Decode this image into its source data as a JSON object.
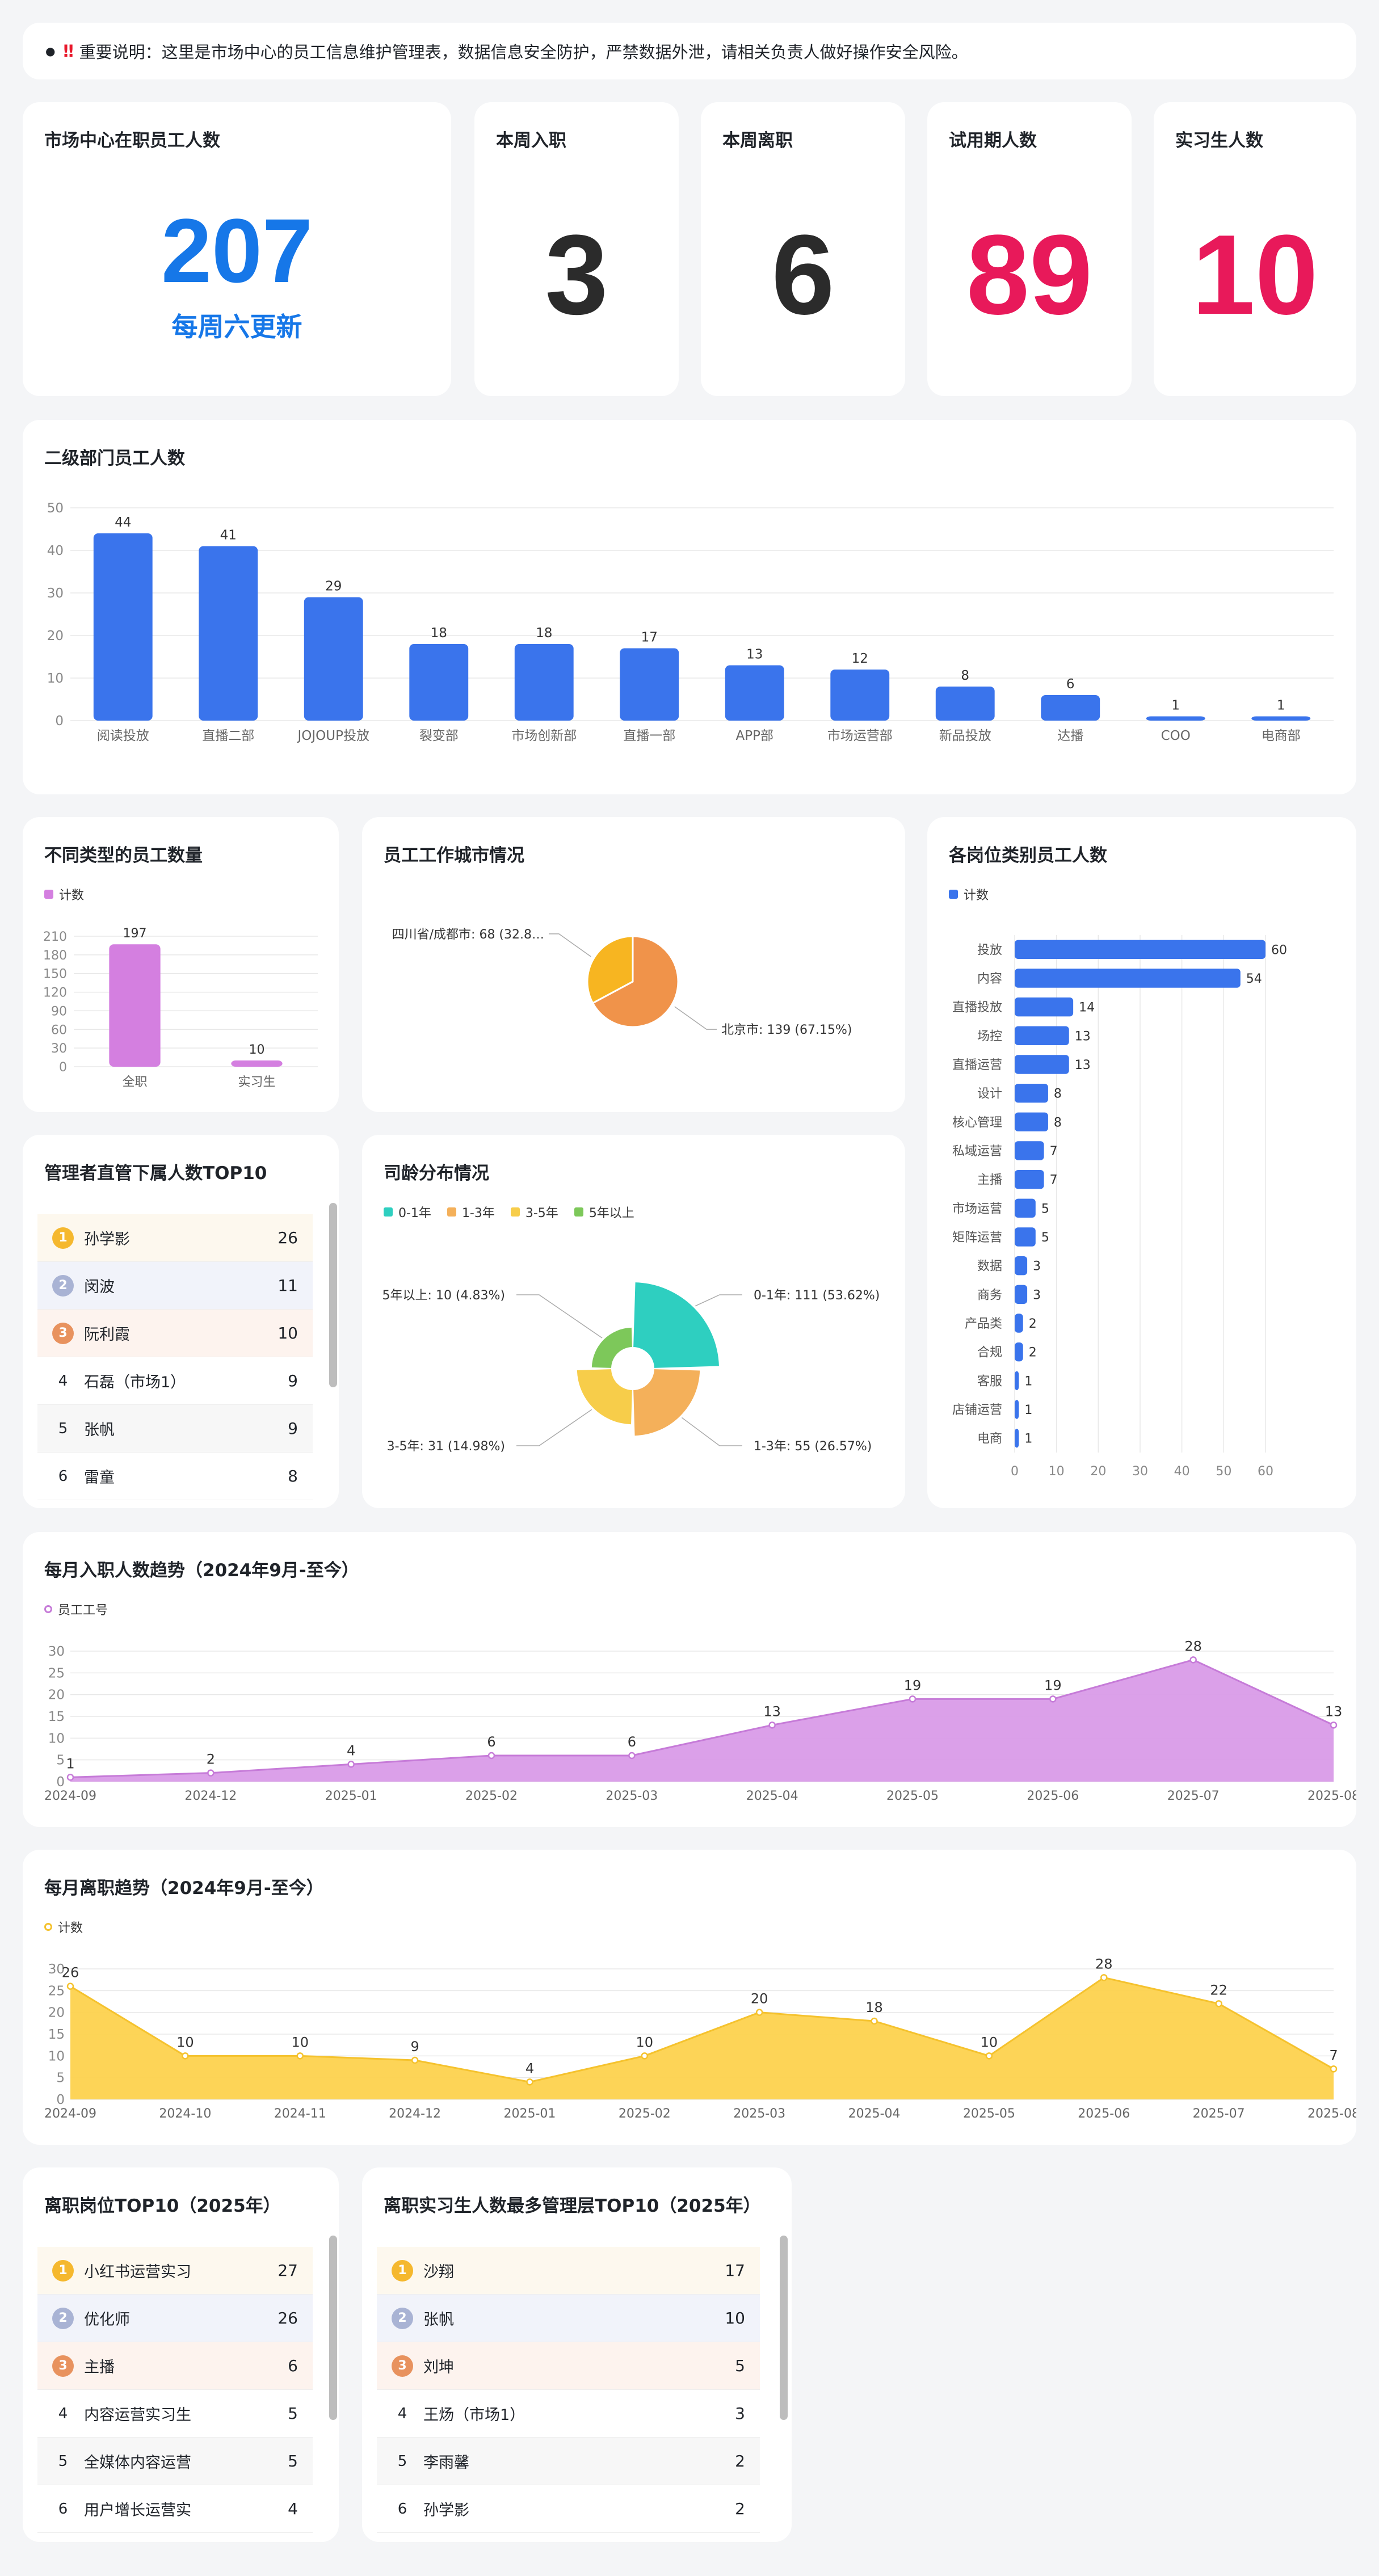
{
  "notice": {
    "bullet": "●",
    "mark": "‼",
    "text": "重要说明：这里是市场中心的员工信息维护管理表，数据信息安全防护，严禁数据外泄，请相关负责人做好操作安全风险。"
  },
  "kpis": {
    "total": {
      "title": "市场中心在职员工人数",
      "value": "207",
      "sub": "每周六更新",
      "color": "#1677e8"
    },
    "joined": {
      "title": "本周入职",
      "value": "3",
      "color": "#2b2b2b"
    },
    "left": {
      "title": "本周离职",
      "value": "6",
      "color": "#2b2b2b"
    },
    "probation": {
      "title": "试用期人数",
      "value": "89",
      "color": "#e8195a"
    },
    "intern": {
      "title": "实习生人数",
      "value": "10",
      "color": "#e8195a"
    }
  },
  "dept_chart": {
    "title": "二级部门员工人数",
    "chart_data": {
      "type": "bar",
      "categories": [
        "阅读投放",
        "直播二部",
        "JOJOUP投放",
        "裂变部",
        "市场创新部",
        "直播一部",
        "APP部",
        "市场运营部",
        "新品投放",
        "达播",
        "COO",
        "电商部"
      ],
      "values": [
        44,
        41,
        29,
        18,
        18,
        17,
        13,
        12,
        8,
        6,
        1,
        1
      ],
      "yticks": [
        0,
        10,
        20,
        30,
        40,
        50
      ],
      "ylim": [
        0,
        50
      ],
      "color": "#3a74ec"
    }
  },
  "type_chart": {
    "title": "不同类型的员工数量",
    "legend": "计数",
    "chart_data": {
      "type": "bar",
      "categories": [
        "全职",
        "实习生"
      ],
      "values": [
        197,
        10
      ],
      "yticks": [
        0,
        30,
        60,
        90,
        120,
        150,
        180,
        210
      ],
      "ylim": [
        0,
        210
      ],
      "color": "#d47fe0"
    }
  },
  "city_chart": {
    "title": "员工工作城市情况",
    "chart_data": {
      "type": "pie",
      "slices": [
        {
          "label": "北京市: 139 (67.15%)",
          "value": 139,
          "color": "#f0934a"
        },
        {
          "label": "四川省/成都市: 68 (32.8…",
          "value": 68,
          "color": "#f7b521"
        }
      ]
    }
  },
  "post_chart": {
    "title": "各岗位类别员工人数",
    "legend": "计数",
    "chart_data": {
      "type": "bar",
      "orientation": "horizontal",
      "categories": [
        "投放",
        "内容",
        "直播投放",
        "场控",
        "直播运营",
        "设计",
        "核心管理",
        "私域运营",
        "主播",
        "市场运营",
        "矩阵运营",
        "数据",
        "商务",
        "产品类",
        "合规",
        "客服",
        "店铺运营",
        "电商"
      ],
      "values": [
        60,
        54,
        14,
        13,
        13,
        8,
        8,
        7,
        7,
        5,
        5,
        3,
        3,
        2,
        2,
        1,
        1,
        1
      ],
      "xticks": [
        0,
        10,
        20,
        30,
        40,
        50,
        60
      ],
      "xlim": [
        0,
        60
      ],
      "color": "#3a74ec"
    }
  },
  "manager_top": {
    "title": "管理者直管下属人数TOP10",
    "rows": [
      {
        "rank": "1",
        "name": "孙学影",
        "value": "26"
      },
      {
        "rank": "2",
        "name": "闵波",
        "value": "11"
      },
      {
        "rank": "3",
        "name": "阮利霞",
        "value": "10"
      },
      {
        "rank": "4",
        "name": "石磊（市场1）",
        "value": "9"
      },
      {
        "rank": "5",
        "name": "张帆",
        "value": "9"
      },
      {
        "rank": "6",
        "name": "雷童",
        "value": "8"
      }
    ]
  },
  "tenure_chart": {
    "title": "司龄分布情况",
    "chart_data": {
      "type": "pie",
      "variant": "rose",
      "slices": [
        {
          "name": "0-1年",
          "label": "0-1年: 111 (53.62%)",
          "value": 111,
          "color": "#2ecfc0"
        },
        {
          "name": "1-3年",
          "label": "1-3年: 55 (26.57%)",
          "value": 55,
          "color": "#f4b05a"
        },
        {
          "name": "3-5年",
          "label": "3-5年: 31 (14.98%)",
          "value": 31,
          "color": "#f7cd4a"
        },
        {
          "name": "5年以上",
          "label": "5年以上: 10 (4.83%)",
          "value": 10,
          "color": "#7dc85a"
        }
      ]
    }
  },
  "hire_trend": {
    "title": "每月入职人数趋势（2024年9月-至今）",
    "legend": "员工工号",
    "chart_data": {
      "type": "area",
      "x": [
        "2024-09",
        "2024-12",
        "2025-01",
        "2025-02",
        "2025-03",
        "2025-04",
        "2025-05",
        "2025-06",
        "2025-07",
        "2025-08"
      ],
      "values": [
        1,
        2,
        4,
        6,
        6,
        13,
        19,
        19,
        28,
        13
      ],
      "yticks": [
        0,
        5,
        10,
        15,
        20,
        25,
        30
      ],
      "ylim": [
        0,
        30
      ],
      "color": "#d99be8",
      "line": "#c67bd8"
    }
  },
  "leave_trend": {
    "title": "每月离职趋势（2024年9月-至今）",
    "legend": "计数",
    "chart_data": {
      "type": "area",
      "x": [
        "2024-09",
        "2024-10",
        "2024-11",
        "2024-12",
        "2025-01",
        "2025-02",
        "2025-03",
        "2025-04",
        "2025-05",
        "2025-06",
        "2025-07",
        "2025-08"
      ],
      "values": [
        26,
        10,
        10,
        9,
        4,
        10,
        20,
        18,
        10,
        28,
        22,
        7
      ],
      "yticks": [
        0,
        5,
        10,
        15,
        20,
        25,
        30
      ],
      "ylim": [
        0,
        30
      ],
      "color": "#fdd24e",
      "line": "#f5c22d"
    }
  },
  "leave_post_top": {
    "title": "离职岗位TOP10（2025年）",
    "rows": [
      {
        "rank": "1",
        "name": "小红书运营实习",
        "value": "27"
      },
      {
        "rank": "2",
        "name": "优化师",
        "value": "26"
      },
      {
        "rank": "3",
        "name": "主播",
        "value": "6"
      },
      {
        "rank": "4",
        "name": "内容运营实习生",
        "value": "5"
      },
      {
        "rank": "5",
        "name": "全媒体内容运营",
        "value": "5"
      },
      {
        "rank": "6",
        "name": "用户增长运营实",
        "value": "4"
      }
    ]
  },
  "leave_intern_top": {
    "title": "离职实习生人数最多管理层TOP10（2025年）",
    "rows": [
      {
        "rank": "1",
        "name": "沙翔",
        "value": "17"
      },
      {
        "rank": "2",
        "name": "张帆",
        "value": "10"
      },
      {
        "rank": "3",
        "name": "刘坤",
        "value": "5"
      },
      {
        "rank": "4",
        "name": "王炀（市场1）",
        "value": "3"
      },
      {
        "rank": "5",
        "name": "李雨馨",
        "value": "2"
      },
      {
        "rank": "6",
        "name": "孙学影",
        "value": "2"
      }
    ]
  }
}
